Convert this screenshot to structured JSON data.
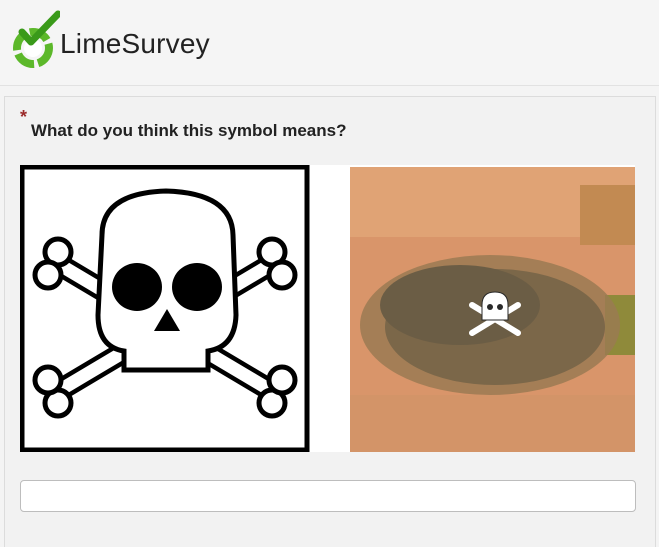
{
  "header": {
    "brand_name": "LimeSurvey",
    "logo_icon": "limesurvey-logo-icon",
    "colors": {
      "logo_green": "#5cb82a",
      "logo_check": "#3a9a1a"
    }
  },
  "question": {
    "required_marker": "*",
    "text": "What do you think this symbol means?",
    "required_color": "#9b2b2b",
    "images": [
      {
        "name": "skull-crossbones-hazard-symbol"
      },
      {
        "name": "pixelated-skull-photo"
      }
    ]
  },
  "answer": {
    "value": "",
    "placeholder": ""
  }
}
